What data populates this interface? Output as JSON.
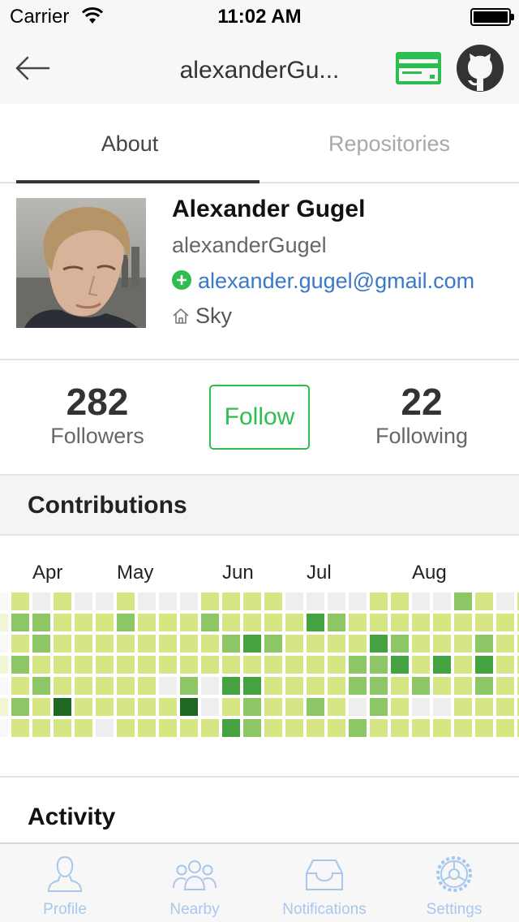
{
  "status_bar": {
    "carrier": "Carrier",
    "time": "11:02 AM"
  },
  "nav": {
    "title": "alexanderGu...",
    "back_icon": "arrow-left-icon",
    "card_icon": "credit-card-icon",
    "github_icon": "github-icon"
  },
  "tabs": [
    {
      "label": "About",
      "active": true
    },
    {
      "label": "Repositories",
      "active": false
    }
  ],
  "profile": {
    "name": "Alexander Gugel",
    "login": "alexanderGugel",
    "email": "alexander.gugel@gmail.com",
    "location": "Sky"
  },
  "stats": {
    "followers_count": "282",
    "followers_label": "Followers",
    "follow_button": "Follow",
    "following_count": "22",
    "following_label": "Following"
  },
  "contributions": {
    "title": "Contributions",
    "months": [
      "Apr",
      "May",
      "Jun",
      "Jul",
      "Aug"
    ],
    "colors": [
      "#eeeeee",
      "#d6e685",
      "#8cc665",
      "#44a340",
      "#1e6823"
    ],
    "weeks": [
      [
        1,
        2,
        1,
        2,
        1,
        2,
        1
      ],
      [
        0,
        2,
        2,
        1,
        2,
        1,
        1
      ],
      [
        1,
        1,
        1,
        1,
        1,
        4,
        1
      ],
      [
        0,
        1,
        1,
        1,
        1,
        1,
        1
      ],
      [
        0,
        1,
        1,
        1,
        1,
        1,
        0
      ],
      [
        1,
        2,
        1,
        1,
        1,
        1,
        1
      ],
      [
        0,
        1,
        1,
        1,
        1,
        1,
        1
      ],
      [
        0,
        1,
        1,
        1,
        0,
        1,
        1
      ],
      [
        0,
        1,
        1,
        1,
        2,
        4,
        1
      ],
      [
        1,
        2,
        1,
        1,
        0,
        0,
        1
      ],
      [
        1,
        1,
        2,
        1,
        3,
        1,
        3
      ],
      [
        1,
        1,
        3,
        1,
        3,
        2,
        2
      ],
      [
        1,
        1,
        2,
        1,
        1,
        1,
        1
      ],
      [
        0,
        1,
        1,
        1,
        1,
        1,
        1
      ],
      [
        0,
        3,
        1,
        1,
        1,
        2,
        1
      ],
      [
        0,
        2,
        1,
        1,
        1,
        1,
        1
      ],
      [
        0,
        1,
        1,
        2,
        2,
        0,
        2
      ],
      [
        1,
        1,
        3,
        2,
        2,
        2,
        1
      ],
      [
        1,
        1,
        2,
        3,
        1,
        1,
        1
      ],
      [
        0,
        1,
        1,
        1,
        2,
        0,
        1
      ],
      [
        0,
        1,
        1,
        3,
        1,
        0,
        1
      ],
      [
        2,
        1,
        1,
        1,
        1,
        1,
        1
      ],
      [
        1,
        1,
        2,
        3,
        2,
        1,
        1
      ],
      [
        0,
        1,
        1,
        1,
        1,
        1,
        1
      ],
      [
        1,
        1,
        1,
        1,
        1,
        1,
        1
      ]
    ]
  },
  "activity": {
    "title": "Activity"
  },
  "tabbar": [
    {
      "label": "Profile",
      "icon": "profile-icon"
    },
    {
      "label": "Nearby",
      "icon": "nearby-users-icon"
    },
    {
      "label": "Notifications",
      "icon": "inbox-icon"
    },
    {
      "label": "Settings",
      "icon": "settings-gear-icon"
    }
  ]
}
